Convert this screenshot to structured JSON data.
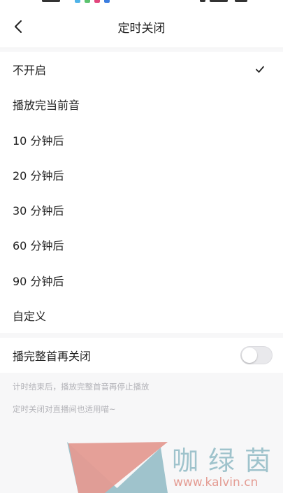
{
  "header": {
    "title": "定时关闭",
    "back_icon": "chevron-left-icon"
  },
  "options": [
    {
      "label": "不开启",
      "selected": true
    },
    {
      "label": "播放完当前音",
      "selected": false
    },
    {
      "label": "10 分钟后",
      "selected": false
    },
    {
      "label": "20 分钟后",
      "selected": false
    },
    {
      "label": "30 分钟后",
      "selected": false
    },
    {
      "label": "60 分钟后",
      "selected": false
    },
    {
      "label": "90 分钟后",
      "selected": false
    },
    {
      "label": "自定义",
      "selected": false
    }
  ],
  "toggle": {
    "label": "播完整首再关闭",
    "on": false
  },
  "notes": {
    "line1": "计时结束后，播放完整首音再停止播放",
    "line2": "定时关闭对直播间也适用喵~"
  },
  "watermark": {
    "text": "咖绿茵",
    "url": "www.kalvin.cn",
    "colors": {
      "teal": "#9fc3cc",
      "salmon": "#e49b92"
    }
  },
  "colors": {
    "background": "#f7f7f8",
    "surface": "#ffffff",
    "text": "#222222",
    "hint": "#b3b3b8"
  }
}
